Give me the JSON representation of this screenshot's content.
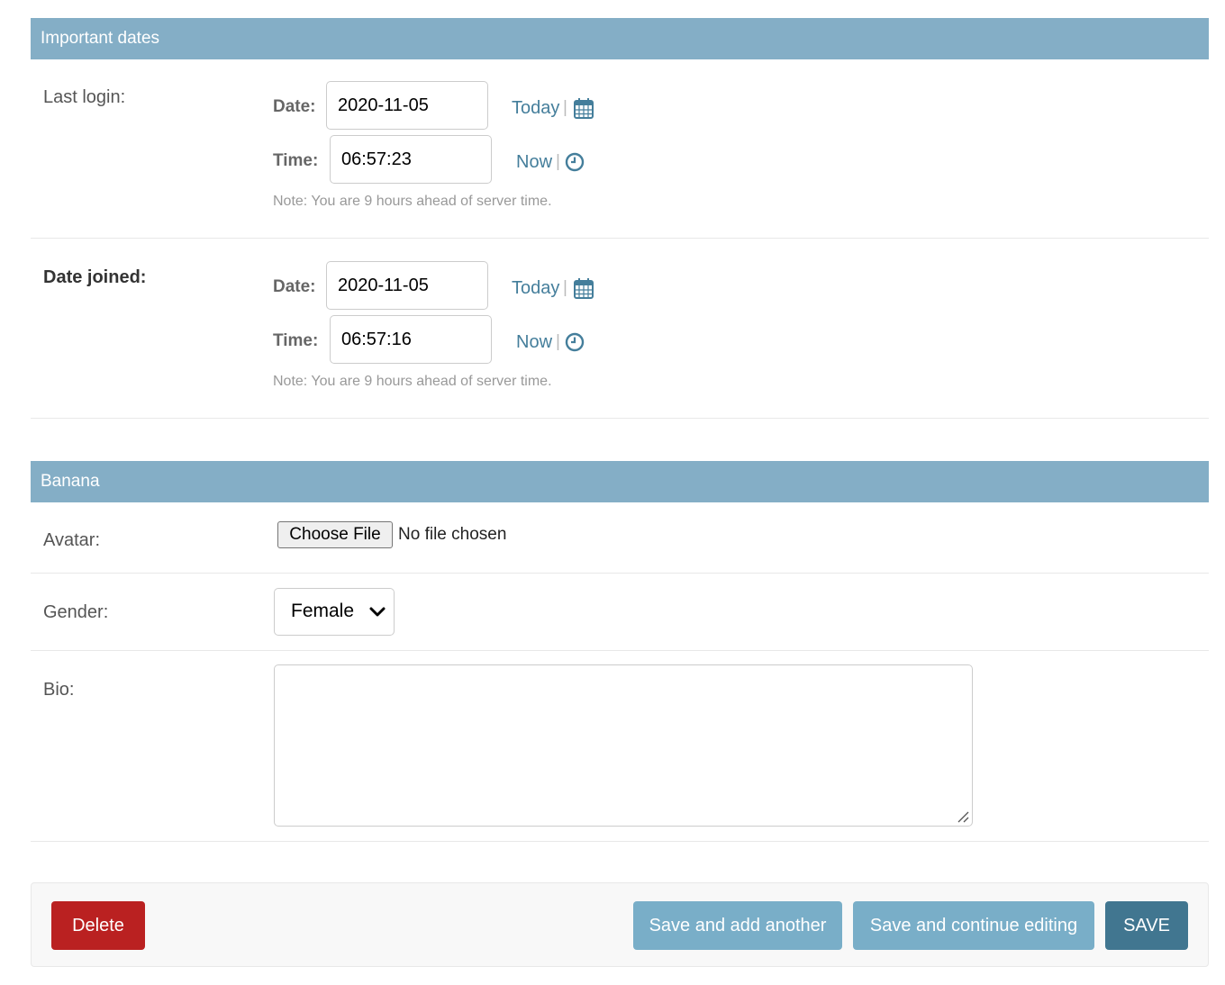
{
  "sections": {
    "important_dates": {
      "title": "Important dates"
    },
    "banana": {
      "title": "Banana"
    }
  },
  "last_login": {
    "label": "Last login:",
    "date_label": "Date:",
    "date_value": "2020-11-05",
    "today_link": "Today",
    "separator": "|",
    "time_label": "Time:",
    "time_value": "06:57:23",
    "now_link": "Now",
    "note": "Note: You are 9 hours ahead of server time."
  },
  "date_joined": {
    "label": "Date joined:",
    "date_label": "Date:",
    "date_value": "2020-11-05",
    "today_link": "Today",
    "separator": "|",
    "time_label": "Time:",
    "time_value": "06:57:16",
    "now_link": "Now",
    "note": "Note: You are 9 hours ahead of server time."
  },
  "avatar": {
    "label": "Avatar:",
    "button": "Choose File",
    "status": "No file chosen"
  },
  "gender": {
    "label": "Gender:",
    "selected": "Female"
  },
  "bio": {
    "label": "Bio:",
    "value": ""
  },
  "actions": {
    "delete": "Delete",
    "save_add_another": "Save and add another",
    "save_continue": "Save and continue editing",
    "save": "SAVE"
  },
  "colors": {
    "header_bg": "#84aec6",
    "link": "#447e9b",
    "delete": "#ba2121",
    "secondary_button": "#79aec8",
    "primary_button": "#417690"
  },
  "icons": {
    "calendar": "calendar-icon",
    "clock": "clock-icon",
    "select": "chevron-down-icon"
  }
}
